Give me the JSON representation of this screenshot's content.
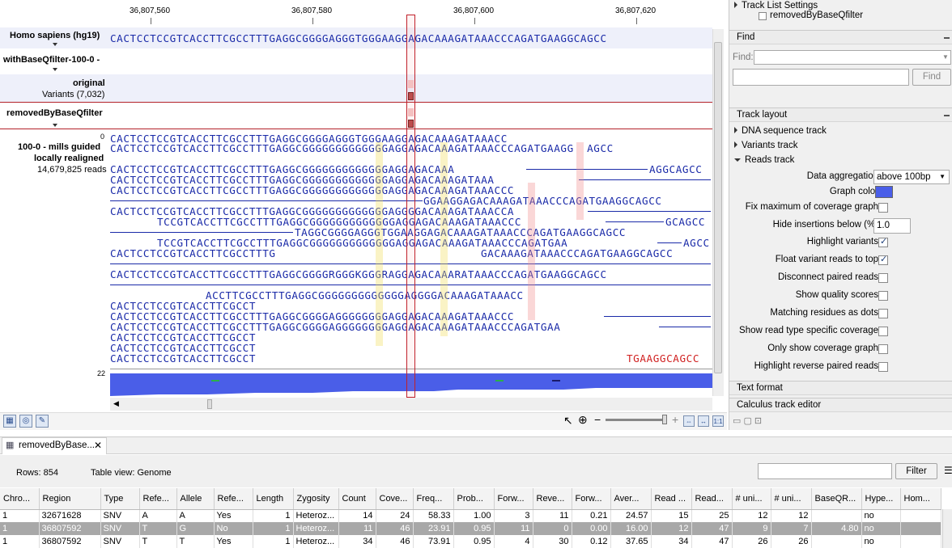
{
  "ruler": {
    "ticks": [
      "36,807,560",
      "36,807,580",
      "36,807,600",
      "36,807,620"
    ]
  },
  "tracks": {
    "reference_name": "Homo sapiens (hg19)",
    "reference_seq": "CACTCCTCCGTCACCTTCGCCTTTGAGGCGGGGAGGGTGGGAAGGAGACAAAGATAAACCCAGATGAAGGCAGCC",
    "filter_track_name": "withBaseQfilter-100-0 -",
    "original_name": "original",
    "original_sub": "Variants (7,032)",
    "removed_name": "removedByBaseQfilter",
    "reads_top_count": "0",
    "reads_name_1": "100-0 - mills guided",
    "reads_name_2": "locally realigned",
    "reads_sub": "14,679,825 reads",
    "coverage_max": "22"
  },
  "reads": [
    "CACTCCTCCGTCACCTTCGCCTTTGAGGCGGGGAGGGTGGGAAGGAGACAAAGATAAACC",
    "CACTCCTCCGTCACCTTCGCCTTTGAGGCGGGGGGGGGGGGGAGGAGACAAAGATAAACCCAGATGAAGG  AGCC",
    "CACTCCTCCGTCACCTTCGCCTTTGAGGCGGGGGGGGGGGGGAGGAGACAAA",
    "CACTCCTCCGTCACCTTCGCCTTTGAGGCGGGGGGGGGGGGGAGGAGACAAAGATAAA",
    "CACTCCTCCGTCACCTTCGCCTTTGAGGCGGGGGGGGGGGGGAGGAGACAAAGATAAACCC",
    "GGAAGGAGACAAAGATAAACCCAGATGAAGGCAGCC",
    "CACTCCTCCGTCACCTTCGCCTTTGAGGCGGGGGGGGGGGGGAGGGGACAAAGATAAACCA",
    "TCCGTCACCTTCGCCTTTGAGGCGGGGGGGGGGGGGAGGAGACAAAGATAAACCC",
    "TAGGCGGGGAGGGTGGAAGGAGACAAAGATAAACCCAGATGAAGGCAGCC",
    "TCCGTCACCTTCGCCTTTGAGGCGGGGGGGGGGGGGAGGAGACAAAGATAAACCCAGATGAA",
    "CACTCCTCCGTCACCTTCGCCTTTG",
    "GACAAAGATAAACCCAGATGAAGGCAGCC",
    "CACTCCTCCGTCACCTTCGCCTTTGAGGCGGGGRGGGKGGGRAGGAGACAAARATAAACCCAGATGAAGGCAGCC",
    "ACCTTCGCCTTTGAGGCGGGGGGGGGGGGGAGGGGACAAAGATAAACC",
    "CACTCCTCCGTCACCTTCGCCT",
    "CACTCCTCCGTCACCTTCGCCTTTGAGGCGGGGAGGGGGGGGAGGAGACAAAGATAAACCC",
    "CACTCCTCCGTCACCTTCGCCTTTGAGGCGGGGAGGGGGGGGAGGAGACAAAGATAAACCCAGATGAA",
    "CACTCCTCCGTCACCTTCGCCT",
    "CACTCCTCCGTCACCTTCGCCT",
    "CACTCCTCCGTCACCTTCGCCT",
    "TGAAGGCAGCC",
    "AGGCAGCC",
    "GCAGCC",
    "AGCC",
    "GCAGCC"
  ],
  "panel": {
    "track_list_settings": "Track List Settings",
    "track_list_item": "removedByBaseQfilter",
    "find_section": "Find",
    "find_label": "Find:",
    "find_button": "Find",
    "track_layout": "Track layout",
    "dna_track": "DNA sequence track",
    "variants_track": "Variants track",
    "reads_track": "Reads track",
    "data_aggregation_label": "Data aggregation",
    "data_aggregation_value": "above 100bp",
    "graph_color_label": "Graph color",
    "graph_color": "#4a5ee8",
    "fix_max_label": "Fix maximum of coverage graph",
    "hide_insertions_label": "Hide insertions below (%)",
    "hide_insertions_value": "1.0",
    "highlight_variants": "Highlight variants",
    "float_variant": "Float variant reads to top",
    "disconnect_pairs": "Disconnect paired reads",
    "show_quality": "Show quality scores",
    "matching_dots": "Matching residues as dots",
    "read_type_cov": "Show read type specific coverage",
    "only_cov": "Only show coverage graph",
    "highlight_reverse": "Highlight reverse paired reads",
    "text_format": "Text format",
    "calculus_editor": "Calculus track editor"
  },
  "bottom": {
    "tab_label": "removedByBase...",
    "rows_label": "Rows: 854",
    "table_view_label": "Table view: Genome",
    "filter_button": "Filter",
    "columns": [
      "Chro...",
      "Region",
      "Type",
      "Refe...",
      "Allele",
      "Refe...",
      "Length",
      "Zygosity",
      "Count",
      "Cove...",
      "Freq...",
      "Prob...",
      "Forw...",
      "Reve...",
      "Forw...",
      "Aver...",
      "Read ...",
      "Read...",
      "# uni...",
      "# uni...",
      "BaseQR...",
      "Hype...",
      "Hom..."
    ],
    "rows": [
      [
        "1",
        "32671628",
        "SNV",
        "A",
        "A",
        "Yes",
        "1",
        "Heteroz...",
        "14",
        "24",
        "58.33",
        "1.00",
        "3",
        "11",
        "0.21",
        "24.57",
        "15",
        "25",
        "12",
        "12",
        "",
        "no",
        ""
      ],
      [
        "1",
        "36807592",
        "SNV",
        "T",
        "G",
        "No",
        "1",
        "Heteroz...",
        "11",
        "46",
        "23.91",
        "0.95",
        "11",
        "0",
        "0.00",
        "16.00",
        "12",
        "47",
        "9",
        "7",
        "4.80",
        "no",
        ""
      ],
      [
        "1",
        "36807592",
        "SNV",
        "T",
        "T",
        "Yes",
        "1",
        "Heteroz...",
        "34",
        "46",
        "73.91",
        "0.95",
        "4",
        "30",
        "0.12",
        "37.65",
        "34",
        "47",
        "26",
        "26",
        "",
        "no",
        ""
      ]
    ]
  }
}
